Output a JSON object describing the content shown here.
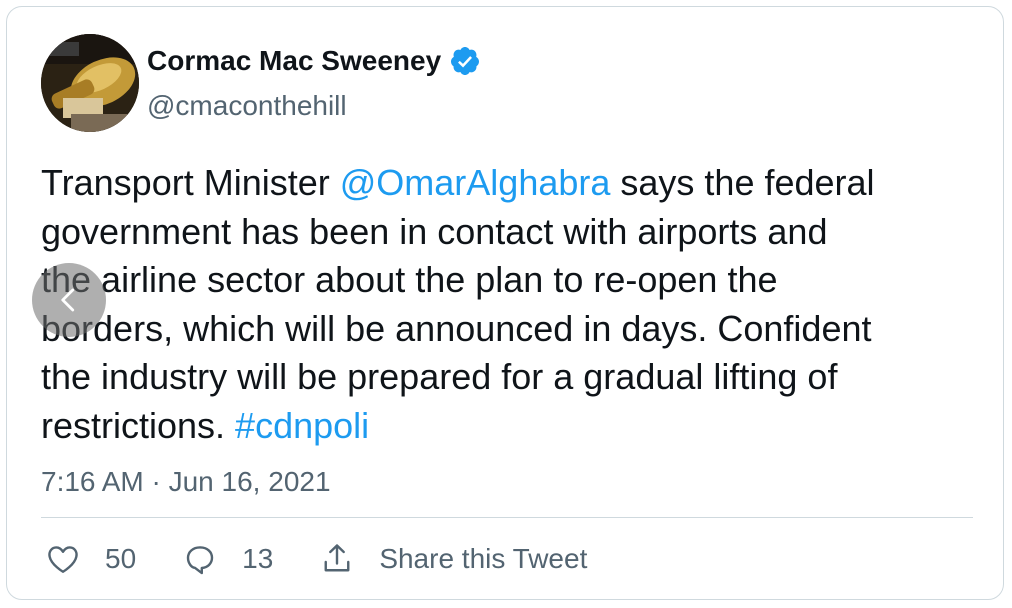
{
  "author": {
    "display_name": "Cormac Mac Sweeney",
    "handle": "@cmaconthehill",
    "verified_icon": "verified-badge-icon",
    "avatar_icon": "microphone-avatar"
  },
  "tweet": {
    "lines": [
      [
        {
          "text": "Transport Minister "
        },
        {
          "text": "@OmarAlghabra",
          "mention": true
        },
        {
          "text": " says the federal"
        }
      ],
      [
        {
          "text": "government has been in contact with airports and"
        }
      ],
      [
        {
          "text": "the airline sector about the plan to re-open the"
        }
      ],
      [
        {
          "text": "borders, which will be announced in days. Confident"
        }
      ],
      [
        {
          "text": "the industry will be prepared for a gradual lifting of"
        }
      ],
      [
        {
          "text": "restrictions. "
        },
        {
          "text": "#cdnpoli",
          "hashtag": true
        }
      ]
    ],
    "timestamp": "7:16 AM · Jun 16, 2021"
  },
  "actions": {
    "like_count": "50",
    "reply_count": "13",
    "share_label": "Share this Tweet"
  },
  "colors": {
    "accent": "#1d9bf0",
    "text": "#0f1419",
    "secondary": "#536471",
    "border": "#cfd9de"
  }
}
